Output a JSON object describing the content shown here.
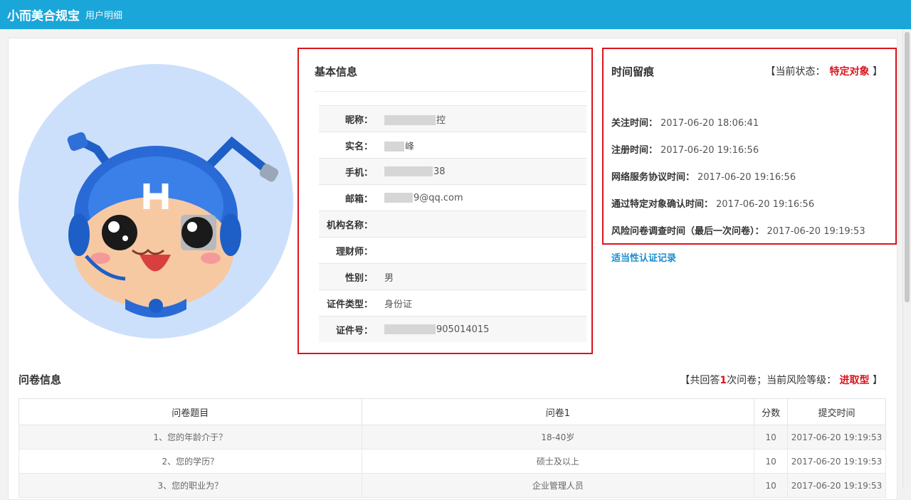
{
  "header": {
    "app_name": "小而美合规宝",
    "page_name": "用户明细"
  },
  "basic_info": {
    "title": "基本信息",
    "rows": [
      {
        "label": "昵称：",
        "value": "控",
        "masked": true
      },
      {
        "label": "实名：",
        "value": "峰",
        "masked": true
      },
      {
        "label": "手机：",
        "value": "38",
        "masked": true
      },
      {
        "label": "邮箱：",
        "value": "9@qq.com",
        "masked": true
      },
      {
        "label": "机构名称：",
        "value": ""
      },
      {
        "label": "理财师：",
        "value": ""
      },
      {
        "label": "性别：",
        "value": "男"
      },
      {
        "label": "证件类型：",
        "value": "身份证"
      },
      {
        "label": "证件号：",
        "value": "905014015",
        "masked": true
      }
    ]
  },
  "time_trace": {
    "title": "时间留痕",
    "status_prefix": "【当前状态：",
    "status_value": "特定对象",
    "status_suffix": "】",
    "rows": [
      {
        "label": "关注时间：",
        "value": "2017-06-20 18:06:41"
      },
      {
        "label": "注册时间：",
        "value": "2017-06-20 19:16:56"
      },
      {
        "label": "网络服务协议时间：",
        "value": "2017-06-20 19:16:56"
      },
      {
        "label": "通过特定对象确认时间：",
        "value": "2017-06-20 19:16:56"
      },
      {
        "label": "风险问卷调查时间（最后一次问卷）：",
        "value": "2017-06-20 19:19:53"
      }
    ],
    "link_label": "适当性认证记录"
  },
  "questionnaire": {
    "title": "问卷信息",
    "summary_prefix": "【共回答",
    "summary_count": "1",
    "summary_mid": "次问卷；当前风险等级：",
    "summary_level": "进取型",
    "summary_suffix": "】",
    "columns": [
      "问卷题目",
      "问卷1",
      "分数",
      "提交时间"
    ],
    "rows": [
      [
        "1、您的年龄介于？",
        "18-40岁",
        "10",
        "2017-06-20 19:19:53"
      ],
      [
        "2、您的学历？",
        "硕士及以上",
        "10",
        "2017-06-20 19:19:53"
      ],
      [
        "3、您的职业为？",
        "企业管理人员",
        "10",
        "2017-06-20 19:19:53"
      ]
    ]
  },
  "colors": {
    "brand": "#1aa6d9",
    "highlight": "#d9141c",
    "link": "#1a8ed0"
  },
  "avatar": {
    "icon": "mascot-avatar",
    "helmet_letter": "H"
  }
}
